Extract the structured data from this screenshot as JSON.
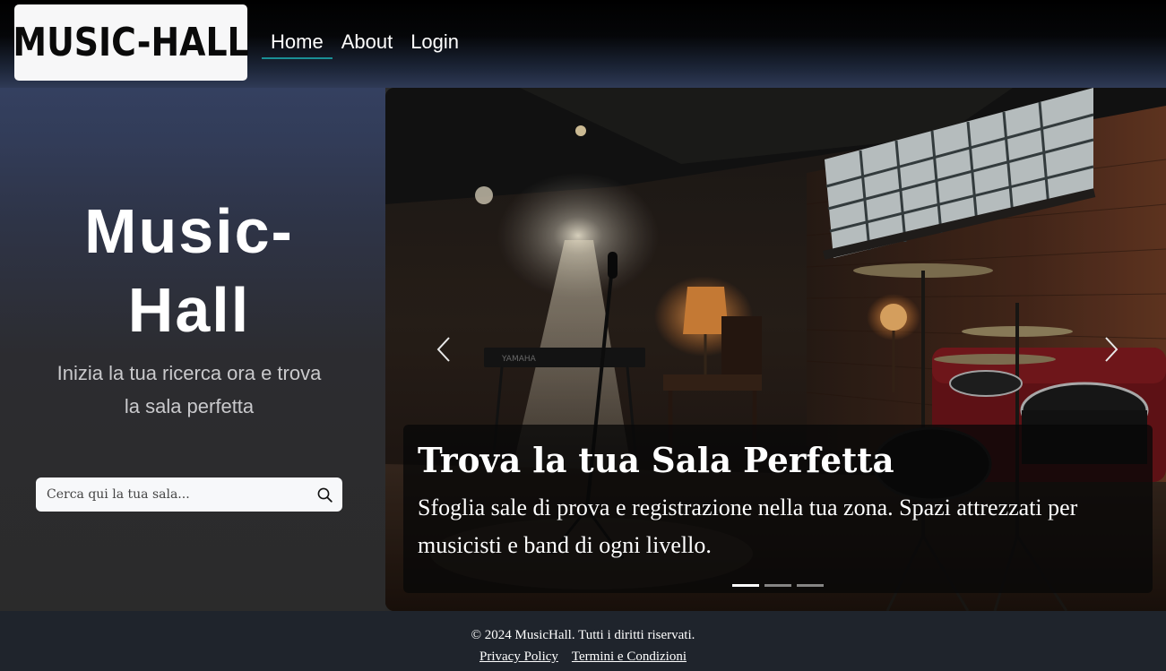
{
  "header": {
    "logo_text": "MUSIC-HALL",
    "nav": {
      "home": "Home",
      "about": "About",
      "login": "Login"
    }
  },
  "hero": {
    "title_line1": "Music-",
    "title_line2": "Hall",
    "subtitle_line1": "Inizia la tua ricerca ora e trova",
    "subtitle_line2": "la sala perfetta",
    "search_placeholder": "Cerca qui la tua sala..."
  },
  "carousel": {
    "caption_title": "Trova la tua Sala Perfetta",
    "caption_text": "Sfoglia sale di prova e registrazione nella tua zona. Spazi attrezzati per musicisti e band di ogni livello.",
    "slide_count": 3,
    "active_slide": 1,
    "image_scene": "rehearsal room with drum kit, microphone stand, keyboard, lamps, brick wall and window",
    "prev_icon": "chevron-left-icon",
    "next_icon": "chevron-right-icon"
  },
  "footer": {
    "copyright": "© 2024 MusicHall. Tutti i diritti riservati.",
    "privacy": "Privacy Policy",
    "terms": "Termini e Condizioni"
  },
  "colors": {
    "nav_active_underline": "#1a8f95",
    "footer_bg": "#1f242c",
    "logo_bg": "#f7f7f8"
  }
}
